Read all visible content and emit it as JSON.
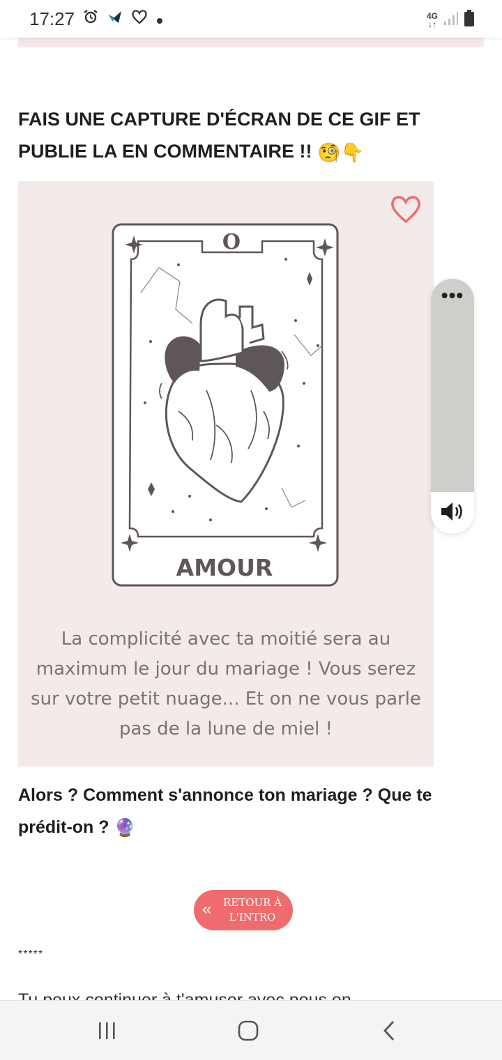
{
  "status_bar": {
    "time": "17:27",
    "icons": [
      "alarm-icon",
      "app-notification-icon",
      "heart-outline-icon",
      "dot-icon"
    ],
    "network": "4G",
    "battery_icon": "battery-icon",
    "signal_icon": "signal-icon"
  },
  "article": {
    "headline": "FAIS UNE CAPTURE D'ÉCRAN DE CE GIF ET PUBLIE LA EN COMMENTAIRE !!",
    "headline_emojis": [
      "🧐",
      "👇"
    ],
    "card": {
      "numeral": "O",
      "title": "AMOUR",
      "caption": "La complicité avec ta moitié sera au maximum le jour du mariage ! Vous serez sur votre petit nuage... Et on ne vous parle pas de la lune de miel !",
      "like_icon": "heart-outline-icon",
      "accent_color": "#ef6b6e",
      "background_color": "#f3eaea"
    },
    "question": "Alors ? Comment s'annonce ton mariage ? Que te prédit-on ?",
    "question_emoji": "🔮",
    "back_button_label": "RETOUR À\nL'INTRO",
    "separator": "*****",
    "cut_off_text": "Tu peux continuer à t'amuser avec nous en"
  },
  "floating_player": {
    "menu_icon": "more-horizontal-icon",
    "volume_icon": "volume-icon"
  },
  "nav_bar": {
    "recent_icon": "recent-apps-icon",
    "home_icon": "home-icon",
    "back_icon": "back-icon"
  }
}
